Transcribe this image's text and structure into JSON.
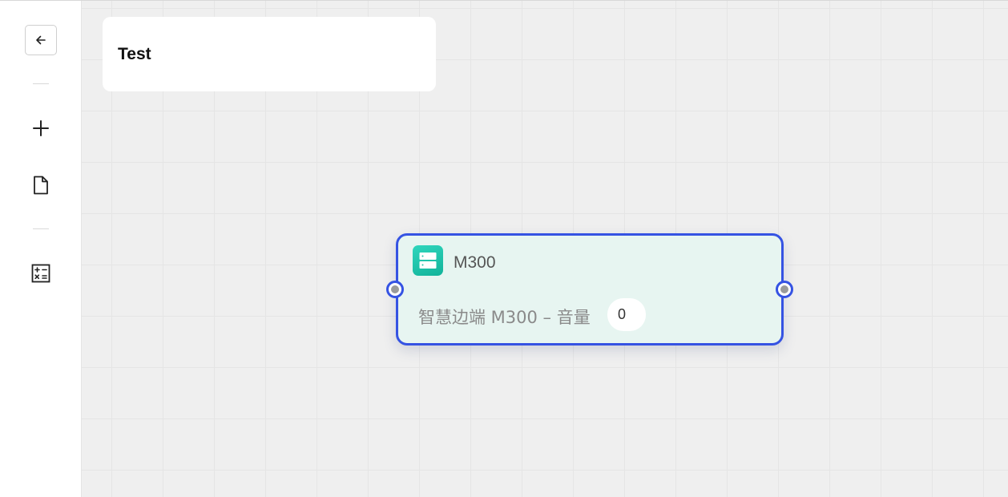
{
  "sidebar": {
    "icons": [
      "arrow-left-icon",
      "plus-icon",
      "file-icon",
      "calculator-icon"
    ]
  },
  "title_card": {
    "text": "Test"
  },
  "node": {
    "title": "M300",
    "description": "智慧边端 M300 – 音量",
    "value": "0",
    "icon": "server-icon",
    "colors": {
      "border": "#3553e3",
      "fill": "#e7f5f1",
      "icon": "#1fc4a9"
    }
  }
}
